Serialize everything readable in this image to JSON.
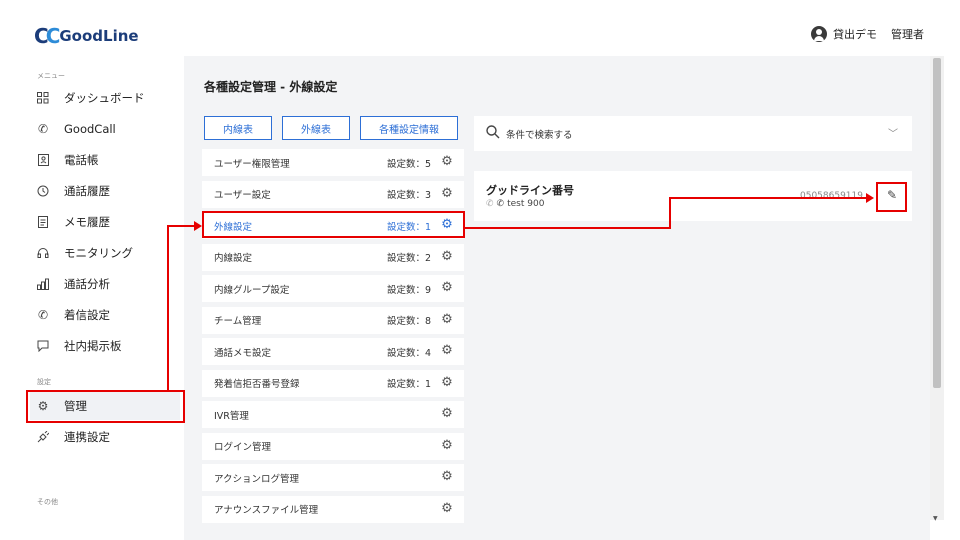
{
  "app": {
    "logo_mark": "CC",
    "logo_word": "GoodLine"
  },
  "user": {
    "name": "貸出デモ",
    "role": "管理者"
  },
  "sidebar": {
    "section_menu": "メニュー",
    "section_settings": "設定",
    "section_other": "その他",
    "items": [
      {
        "label": "ダッシュボード",
        "icon": "dashboard-icon"
      },
      {
        "label": "GoodCall",
        "icon": "phone-icon"
      },
      {
        "label": "電話帳",
        "icon": "contacts-icon"
      },
      {
        "label": "通話履歴",
        "icon": "history-icon"
      },
      {
        "label": "メモ履歴",
        "icon": "memo-icon"
      },
      {
        "label": "モニタリング",
        "icon": "headset-icon"
      },
      {
        "label": "通話分析",
        "icon": "chart-icon"
      },
      {
        "label": "着信設定",
        "icon": "incoming-call-icon"
      },
      {
        "label": "社内掲示板",
        "icon": "board-icon"
      }
    ],
    "settings_items": [
      {
        "label": "管理",
        "icon": "gear-icon"
      },
      {
        "label": "連携設定",
        "icon": "plug-icon"
      }
    ]
  },
  "main": {
    "title": "各種設定管理 - 外線設定",
    "tabs": [
      {
        "label": "内線表"
      },
      {
        "label": "外線表"
      },
      {
        "label": "各種設定情報"
      }
    ],
    "settings_list": [
      {
        "name": "ユーザー権限管理",
        "count": "設定数：5"
      },
      {
        "name": "ユーザー設定",
        "count": "設定数：3"
      },
      {
        "name": "外線設定",
        "count": "設定数：1"
      },
      {
        "name": "内線設定",
        "count": "設定数：2"
      },
      {
        "name": "内線グループ設定",
        "count": "設定数：9"
      },
      {
        "name": "チーム管理",
        "count": "設定数：8"
      },
      {
        "name": "通話メモ設定",
        "count": "設定数：4"
      },
      {
        "name": "発着信拒否番号登録",
        "count": "設定数：1"
      },
      {
        "name": "IVR管理",
        "count": ""
      },
      {
        "name": "ログイン管理",
        "count": ""
      },
      {
        "name": "アクションログ管理",
        "count": ""
      },
      {
        "name": "アナウンスファイル管理",
        "count": ""
      }
    ],
    "search": {
      "placeholder": "条件で検索する"
    },
    "card": {
      "title": "グッドライン番号",
      "sub": "test 900",
      "number": "05058659119"
    }
  },
  "colors": {
    "accent": "#2d6fd6",
    "annotation": "#e60000",
    "background": "#f3f4f6"
  }
}
